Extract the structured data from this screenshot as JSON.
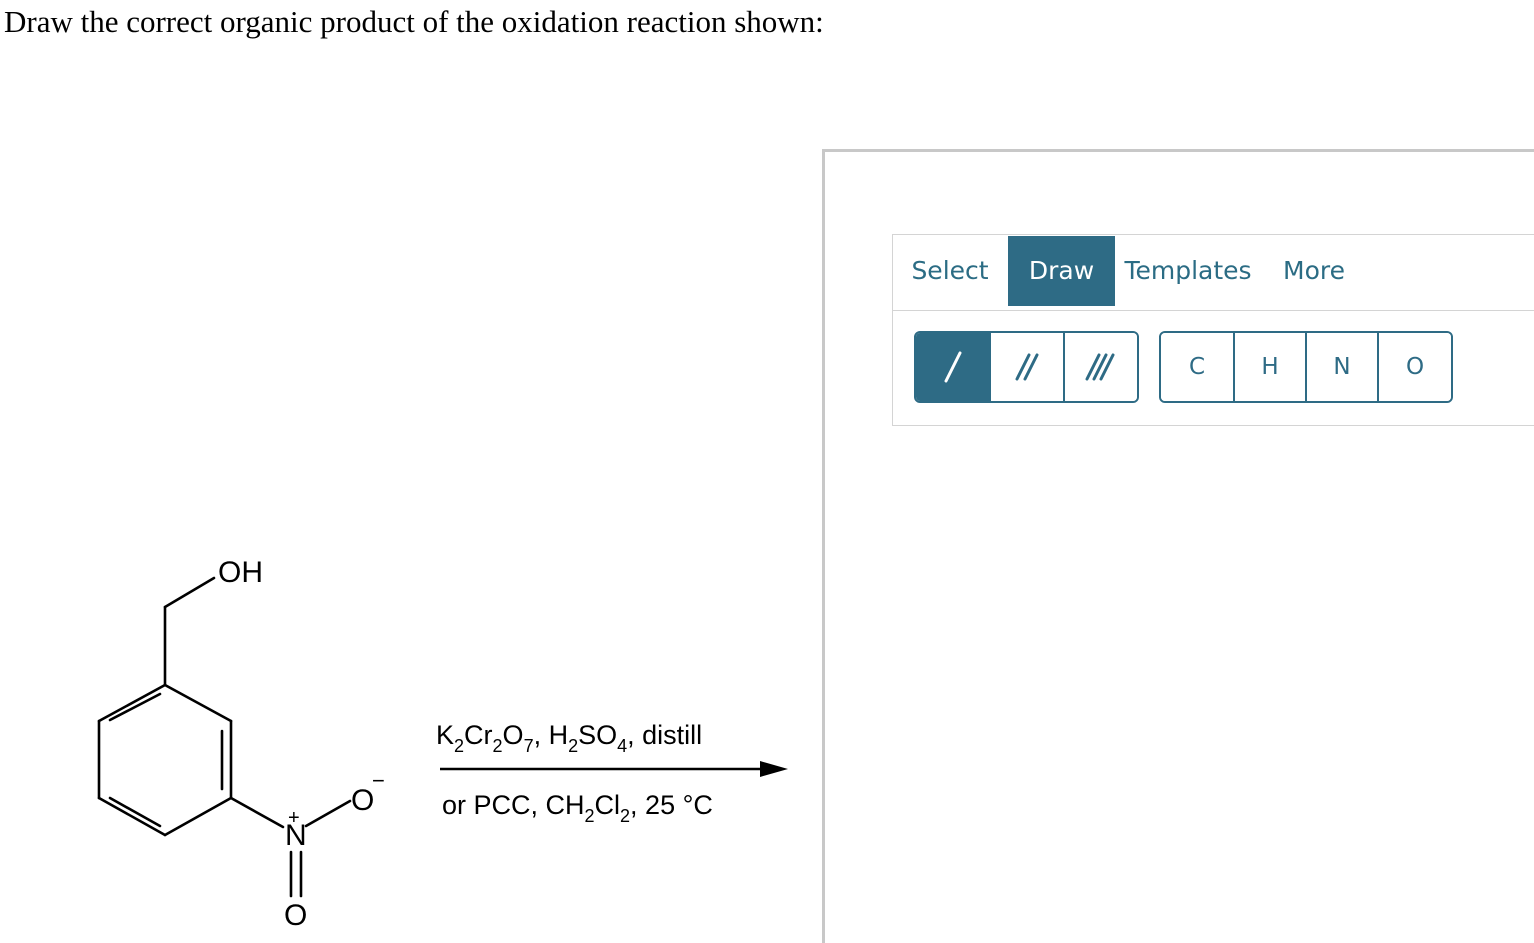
{
  "question": "Draw the correct organic product of the oxidation reaction shown:",
  "reaction": {
    "atoms": {
      "hydroxyl": "OH",
      "nitro_n": "N",
      "nitro_o_single": "O",
      "nitro_o_double": "O",
      "plus_charge": "+",
      "minus_charge": "−"
    },
    "conditions_top": {
      "k": "K",
      "k_sub": "2",
      "cr": "Cr",
      "cr_sub": "2",
      "o": "O",
      "o_sub": "7",
      "sep1": ", ",
      "h": "H",
      "h_sub": "2",
      "so": "SO",
      "so_sub": "4",
      "rest": ", distill"
    },
    "conditions_bottom": {
      "pre": "or PCC, CH",
      "h_sub": "2",
      "cl": "Cl",
      "cl_sub": "2",
      "rest": ", 25 °C"
    }
  },
  "sketcher": {
    "tabs": [
      "Select",
      "Draw",
      "Templates",
      "More"
    ],
    "active_tab": "Draw",
    "bond_tools": [
      {
        "name": "single-bond",
        "glyph": "/",
        "active": true
      },
      {
        "name": "double-bond",
        "glyph": "//",
        "active": false
      },
      {
        "name": "triple-bond",
        "glyph": "///",
        "active": false
      }
    ],
    "atom_tools": [
      "C",
      "H",
      "N",
      "O"
    ],
    "accent_color": "#2e6b85"
  }
}
